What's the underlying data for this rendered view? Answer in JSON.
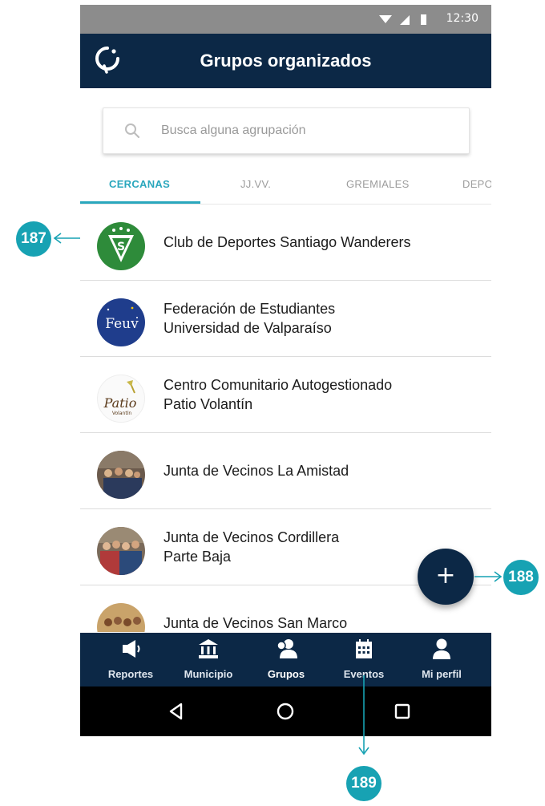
{
  "status_bar": {
    "time": "12:30"
  },
  "app_bar": {
    "title": "Grupos organizados"
  },
  "search": {
    "placeholder": "Busca alguna agrupación"
  },
  "tabs": [
    {
      "label": "CERCANAS",
      "active": true
    },
    {
      "label": "JJ.VV.",
      "active": false
    },
    {
      "label": "GREMIALES",
      "active": false
    },
    {
      "label": "DEPO",
      "active": false
    }
  ],
  "groups": [
    {
      "line1": "Club de Deportes Santiago Wanderers",
      "line2": ""
    },
    {
      "line1": "Federación de Estudiantes",
      "line2": "Universidad de Valparaíso"
    },
    {
      "line1": "Centro Comunitario Autogestionado",
      "line2": "Patio Volantín"
    },
    {
      "line1": "Junta de Vecinos La Amistad",
      "line2": ""
    },
    {
      "line1": "Junta de Vecinos Cordillera",
      "line2": "Parte Baja"
    },
    {
      "line1": "Junta de Vecinos San Marco",
      "line2": ""
    }
  ],
  "avatar_logos": {
    "feuv": "Feuv",
    "patio": "Patio",
    "patio_sub": "Volantín"
  },
  "fab": {
    "symbol": "+"
  },
  "bottom_nav": [
    {
      "label": "Reportes",
      "icon": "megaphone-icon"
    },
    {
      "label": "Municipio",
      "icon": "building-icon"
    },
    {
      "label": "Grupos",
      "icon": "group-icon"
    },
    {
      "label": "Eventos",
      "icon": "calendar-icon"
    },
    {
      "label": "Mi perfil",
      "icon": "person-icon"
    }
  ],
  "callouts": {
    "c187": "187",
    "c188": "188",
    "c189": "189"
  },
  "colors": {
    "primary": "#0c2846",
    "accent": "#2aa7bd",
    "callout": "#17a2b3"
  }
}
